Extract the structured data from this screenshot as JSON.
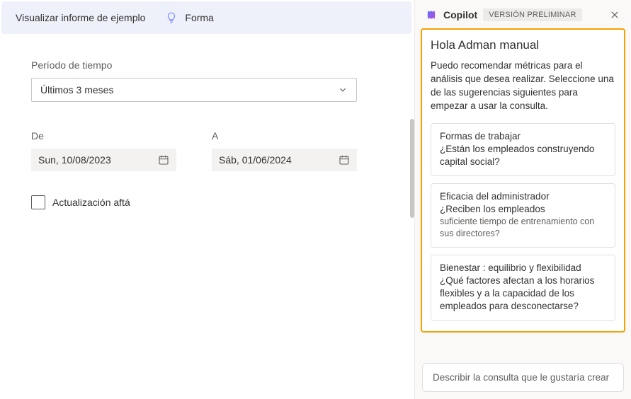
{
  "topbar": {
    "preview_link": "Visualizar informe de ejemplo",
    "shape_link": "Forma"
  },
  "form": {
    "period_label": "Período de tiempo",
    "period_value": "Últimos 3 meses",
    "from_label": "De",
    "from_value": "Sun, 10/08/2023",
    "to_label": "A",
    "to_value": "Sáb, 01/06/2024",
    "checkbox_label": "Actualización aftá"
  },
  "copilot": {
    "title": "Copilot",
    "badge": "VERSIÓN PRELIMINAR",
    "greeting": "Hola Adman manual",
    "intro": "Puedo recomendar métricas para el análisis que desea realizar. Seleccione una de las sugerencias siguientes para empezar a usar la consulta.",
    "suggestions": [
      {
        "title": "Formas de trabajar",
        "question": "¿Están los empleados construyendo capital social?",
        "sub": ""
      },
      {
        "title": "Eficacia del administrador",
        "question": "¿Reciben los empleados",
        "sub": "suficiente tiempo de entrenamiento con sus directores?"
      },
      {
        "title": "Bienestar : equilibrio y flexibilidad",
        "question": "¿Qué factores afectan a los horarios flexibles y a la capacidad de los empleados para desconectarse?",
        "sub": ""
      }
    ],
    "prompt_placeholder": "Describir la consulta que le gustaría crear"
  }
}
